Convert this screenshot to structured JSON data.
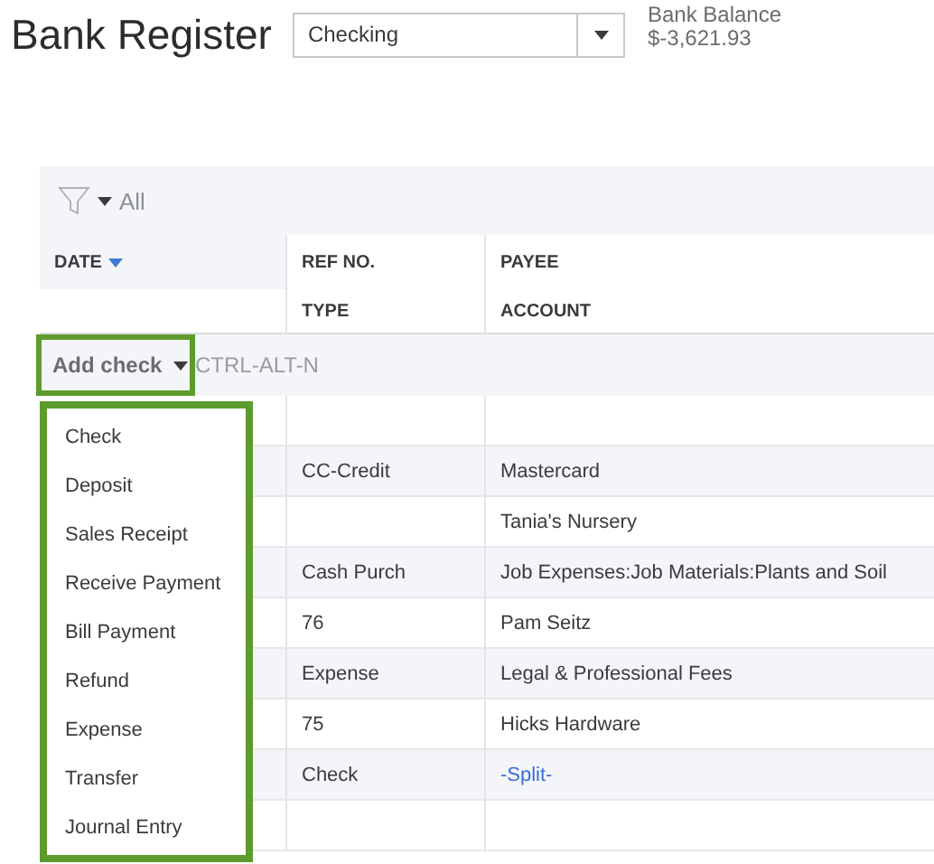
{
  "title": "Bank Register",
  "account_select": {
    "value": "Checking"
  },
  "balance": {
    "label": "Bank Balance",
    "amount": "$-3,621.93"
  },
  "filter": {
    "label": "All"
  },
  "columns": {
    "date": "DATE",
    "ref_no": "REF NO.",
    "type": "TYPE",
    "payee": "PAYEE",
    "account": "ACCOUNT"
  },
  "add_button": {
    "label": "Add check",
    "shortcut": "CTRL-ALT-N"
  },
  "menu": [
    "Check",
    "Deposit",
    "Sales Receipt",
    "Receive Payment",
    "Bill Payment",
    "Refund",
    "Expense",
    "Transfer",
    "Journal Entry"
  ],
  "rows": [
    {},
    {
      "type": "CC-Credit",
      "account": "Mastercard",
      "kind": "text"
    },
    {
      "account": "Tania's Nursery",
      "kind": "text"
    },
    {
      "type": "Cash Purch",
      "account": "Job Expenses:Job Materials:Plants and Soil",
      "kind": "text"
    },
    {
      "type": "76",
      "account": "Pam Seitz",
      "kind": "text"
    },
    {
      "type": "Expense",
      "account": "Legal & Professional Fees",
      "kind": "text"
    },
    {
      "type": "75",
      "account": "Hicks Hardware",
      "kind": "text"
    },
    {
      "type": "Check",
      "account": "-Split-",
      "kind": "link"
    },
    {}
  ]
}
